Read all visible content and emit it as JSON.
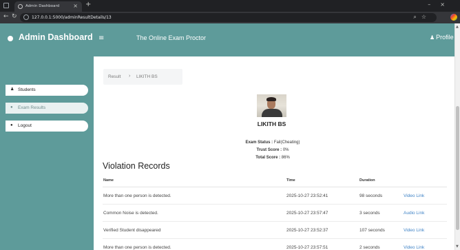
{
  "browser": {
    "tab_title": "Admin Dashboard",
    "url": "127.0.0.1:5000/adminResultDetails/13"
  },
  "header": {
    "brand": "Admin Dashboard",
    "menu_icon": "hamburger-icon",
    "title": "The Online Exam Proctor",
    "profile_label": "Profile"
  },
  "sidebar": {
    "items": [
      {
        "label": "Students",
        "icon": "user-icon"
      },
      {
        "label": "Exam Results",
        "icon": "results-icon"
      },
      {
        "label": "Logout",
        "icon": "logout-icon"
      }
    ]
  },
  "breadcrumb": {
    "parent": "Result",
    "current": "LIKITH BS"
  },
  "student": {
    "name": "LIKITH BS"
  },
  "summary": {
    "status_label": "Exam Status :",
    "status_value": "Fail(Cheating)",
    "trust_label": "Trust Score :",
    "trust_value": "0%",
    "total_label": "Total Score :",
    "total_value": "86%"
  },
  "violations": {
    "title": "Violation Records",
    "columns": [
      "Name",
      "Time",
      "Duration"
    ],
    "rows": [
      {
        "name": "More than one person is detected.",
        "time": "2025-10-27 23:52:41",
        "duration": "98 seconds",
        "link": "Video Link"
      },
      {
        "name": "Common Noise is detected.",
        "time": "2025-10-27 23:57:47",
        "duration": "3 seconds",
        "link": "Audio Link"
      },
      {
        "name": "Verified Student disappeared",
        "time": "2025-10-27 23:52:37",
        "duration": "107 seconds",
        "link": "Video Link"
      },
      {
        "name": "More than one person is detected.",
        "time": "2025-10-27 23:57:51",
        "duration": "2 seconds",
        "link": "Video Link"
      }
    ]
  }
}
